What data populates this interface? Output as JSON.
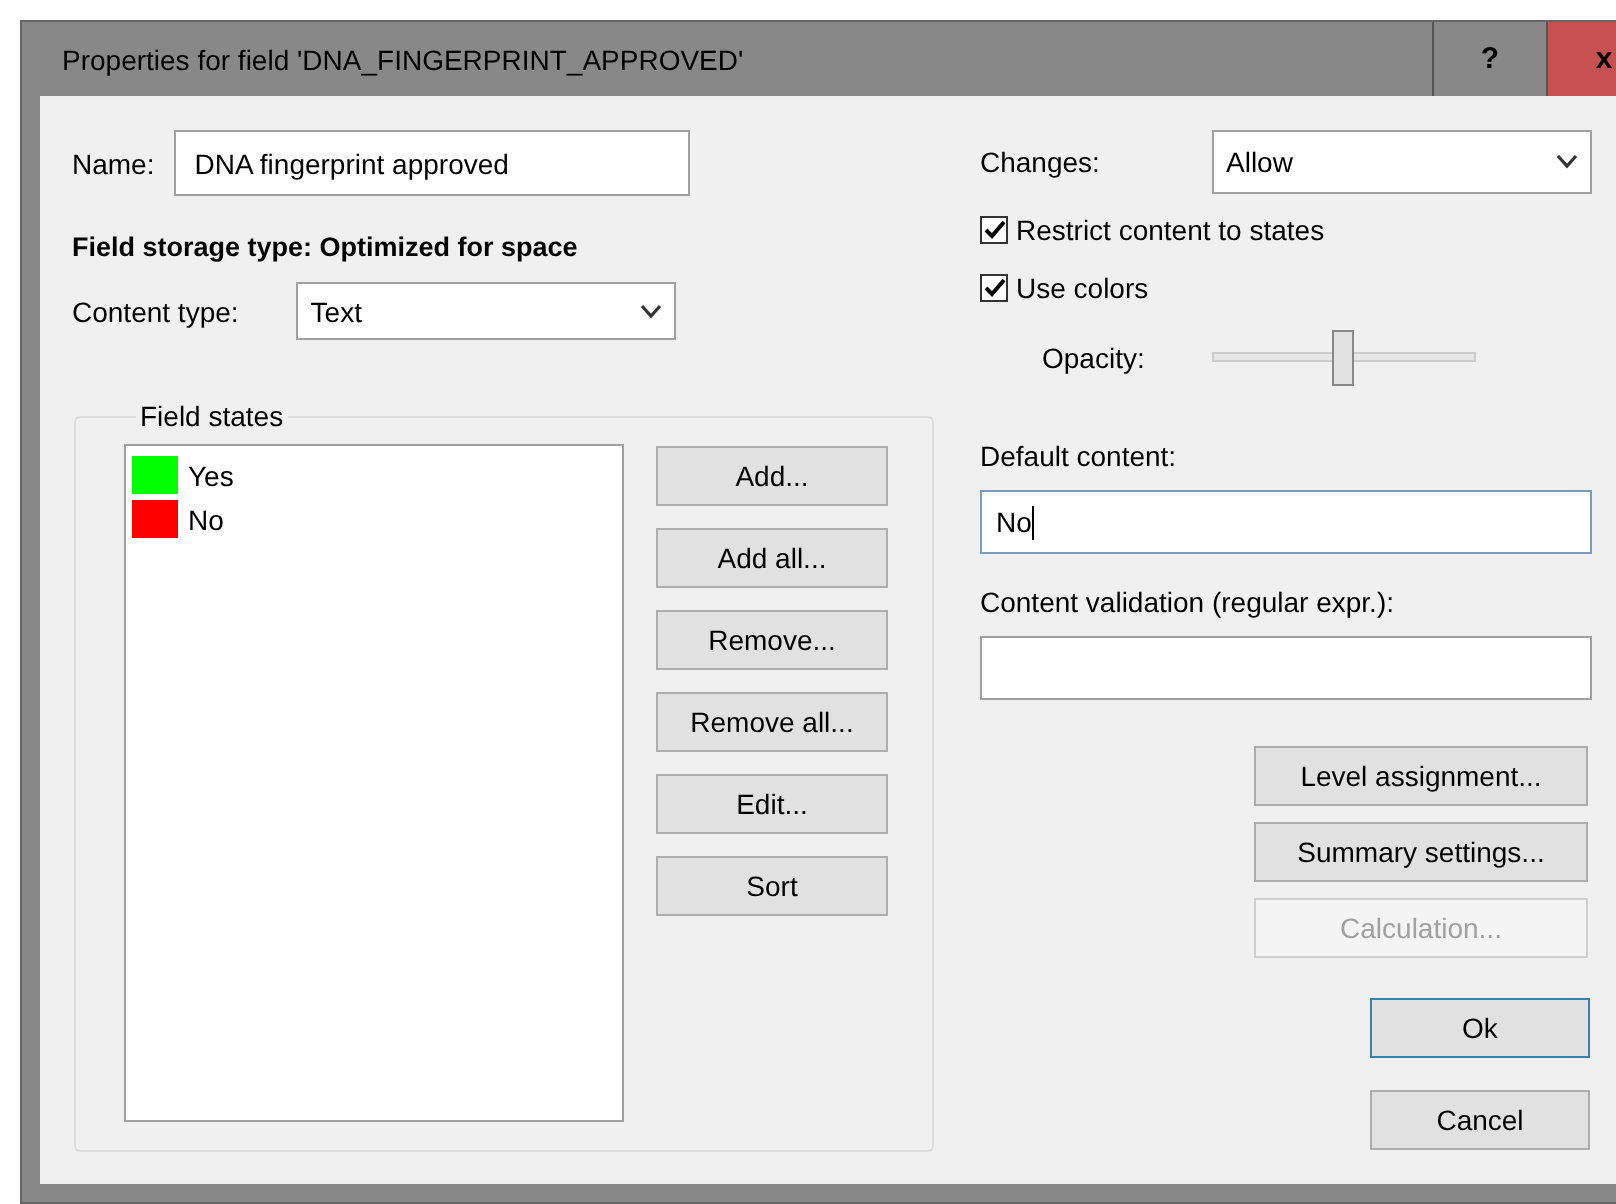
{
  "window": {
    "title": "Properties for field 'DNA_FINGERPRINT_APPROVED'",
    "help": "?",
    "close": "x"
  },
  "name": {
    "label": "Name:",
    "value": "DNA fingerprint approved"
  },
  "storage_type": "Field storage type: Optimized for space",
  "content_type": {
    "label": "Content type:",
    "value": "Text"
  },
  "field_states": {
    "title": "Field states",
    "items": [
      {
        "label": "Yes",
        "color": "#00ff00"
      },
      {
        "label": "No",
        "color": "#ff0000"
      }
    ],
    "buttons": [
      "Add...",
      "Add all...",
      "Remove...",
      "Remove all...",
      "Edit...",
      "Sort"
    ]
  },
  "changes": {
    "label": "Changes:",
    "value": "Allow"
  },
  "checkboxes": [
    {
      "label": "Restrict content to states",
      "checked": true
    },
    {
      "label": "Use colors",
      "checked": true
    }
  ],
  "opacity": {
    "label": "Opacity:",
    "level": 0.5
  },
  "default_content": {
    "label": "Default content:",
    "value": "No"
  },
  "content_validation": {
    "label": "Content validation (regular expr.):"
  },
  "side_buttons": [
    {
      "label": "Level assignment...",
      "disabled": false
    },
    {
      "label": "Summary settings...",
      "disabled": false
    },
    {
      "label": "Calculation...",
      "disabled": true
    }
  ],
  "dialog_buttons": [
    {
      "label": "Ok",
      "default": true
    },
    {
      "label": "Cancel",
      "default": false
    }
  ]
}
